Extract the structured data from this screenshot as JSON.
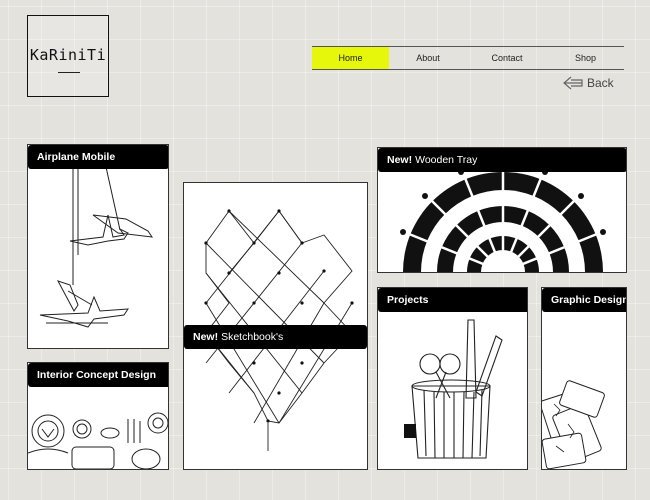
{
  "logo": {
    "text": "KaRiniTi"
  },
  "nav": {
    "items": [
      {
        "label": "Home",
        "active": true
      },
      {
        "label": "About",
        "active": false
      },
      {
        "label": "Contact",
        "active": false
      },
      {
        "label": "Shop",
        "active": false
      }
    ],
    "active_color": "#e7f70b"
  },
  "back": {
    "label": "Back",
    "icon": "left-arrow-icon"
  },
  "cards": {
    "airplane_mobile": {
      "title": "Airplane Mobile"
    },
    "sketchbooks": {
      "prefix": "New!",
      "title": "Sketchbook's"
    },
    "wooden_tray": {
      "prefix": "New!",
      "title": "Wooden Tray"
    },
    "interior_concept": {
      "title": "Interior Concept Design"
    },
    "projects": {
      "title": "Projects"
    },
    "graphic_design": {
      "title": "Graphic Design"
    }
  },
  "colors": {
    "background": "#e3e2dd",
    "label_bg": "#000000",
    "accent": "#e7f70b"
  }
}
